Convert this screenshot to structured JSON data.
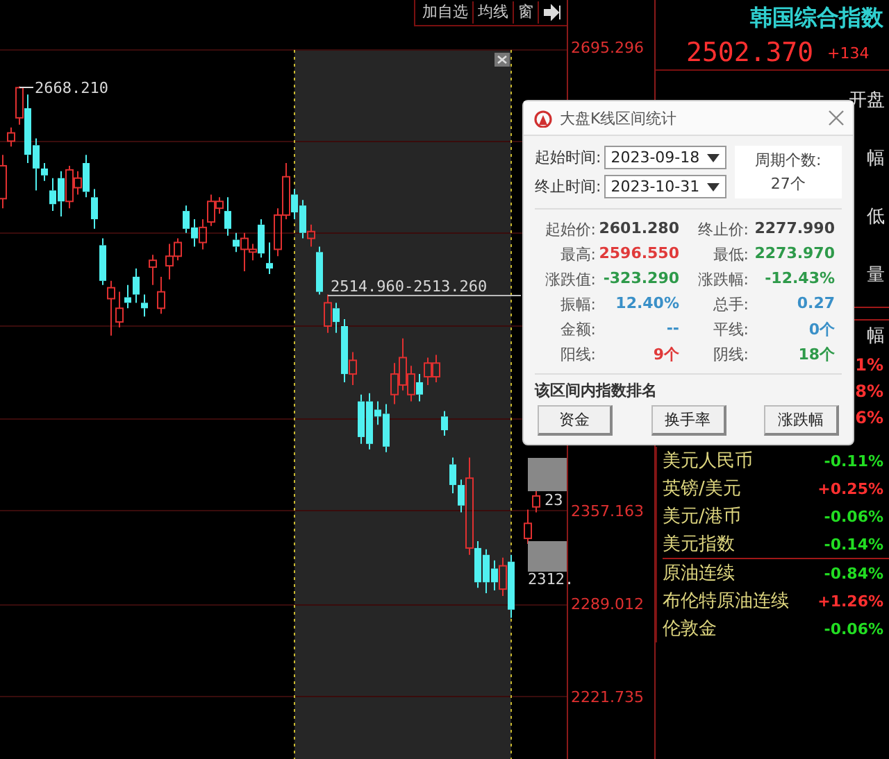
{
  "toolbar": {
    "buttons": [
      "加自选",
      "均线",
      "窗"
    ]
  },
  "chart": {
    "high_label": "2668.210",
    "range_label": "2514.960-2513.260",
    "price_tags": [
      "23",
      "2312."
    ],
    "chart_data": {
      "type": "candlestick",
      "grid": true,
      "ylim": [
        2178,
        2732
      ],
      "yticks": [
        {
          "value": 2695.296,
          "label": "2695.296"
        },
        {
          "value": 2357.163,
          "label": "2357.163"
        },
        {
          "value": 2289.012,
          "label": "2289.012"
        },
        {
          "value": 2221.735,
          "label": "2221.735"
        }
      ],
      "ohlc": [
        [
          2587,
          2619,
          2580,
          2611
        ],
        [
          2629,
          2639,
          2625,
          2635
        ],
        [
          2646,
          2669,
          2641,
          2668
        ],
        [
          2653,
          2663,
          2613,
          2619
        ],
        [
          2626,
          2631,
          2593,
          2609
        ],
        [
          2609,
          2613,
          2600,
          2604
        ],
        [
          2593,
          2602,
          2578,
          2583
        ],
        [
          2602,
          2607,
          2574,
          2585
        ],
        [
          2585,
          2611,
          2580,
          2608
        ],
        [
          2595,
          2607,
          2590,
          2602
        ],
        [
          2613,
          2619,
          2588,
          2592
        ],
        [
          2588,
          2594,
          2565,
          2572
        ],
        [
          2553,
          2558,
          2524,
          2527
        ],
        [
          2514,
          2527,
          2487,
          2522
        ],
        [
          2497,
          2519,
          2493,
          2507
        ],
        [
          2515,
          2524,
          2507,
          2511
        ],
        [
          2530,
          2536,
          2511,
          2517
        ],
        [
          2511,
          2517,
          2501,
          2507
        ],
        [
          2537,
          2546,
          2524,
          2542
        ],
        [
          2507,
          2530,
          2503,
          2519
        ],
        [
          2538,
          2554,
          2528,
          2545
        ],
        [
          2545,
          2558,
          2542,
          2555
        ],
        [
          2578,
          2582,
          2562,
          2565
        ],
        [
          2566,
          2572,
          2552,
          2558
        ],
        [
          2555,
          2572,
          2550,
          2566
        ],
        [
          2570,
          2590,
          2567,
          2585
        ],
        [
          2580,
          2588,
          2576,
          2585
        ],
        [
          2578,
          2588,
          2560,
          2565
        ],
        [
          2557,
          2562,
          2548,
          2552
        ],
        [
          2550,
          2562,
          2534,
          2558
        ],
        [
          2548,
          2554,
          2542,
          2550
        ],
        [
          2568,
          2572,
          2544,
          2547
        ],
        [
          2540,
          2555,
          2532,
          2536
        ],
        [
          2550,
          2580,
          2545,
          2575
        ],
        [
          2575,
          2613,
          2572,
          2603
        ],
        [
          2590,
          2594,
          2572,
          2577
        ],
        [
          2582,
          2586,
          2558,
          2562
        ],
        [
          2558,
          2568,
          2552,
          2563
        ],
        [
          2548,
          2552,
          2517,
          2519
        ],
        [
          2494,
          2517,
          2489,
          2511
        ],
        [
          2507,
          2511,
          2489,
          2497
        ],
        [
          2494,
          2499,
          2453,
          2459
        ],
        [
          2459,
          2475,
          2451,
          2469
        ],
        [
          2439,
          2444,
          2408,
          2413
        ],
        [
          2439,
          2445,
          2404,
          2408
        ],
        [
          2433,
          2439,
          2422,
          2428
        ],
        [
          2430,
          2437,
          2402,
          2406
        ],
        [
          2444,
          2467,
          2437,
          2459
        ],
        [
          2451,
          2485,
          2447,
          2471
        ],
        [
          2444,
          2465,
          2439,
          2459
        ],
        [
          2453,
          2459,
          2439,
          2444
        ],
        [
          2457,
          2471,
          2451,
          2467
        ],
        [
          2457,
          2473,
          2453,
          2467
        ],
        [
          2428,
          2432,
          2414,
          2418
        ],
        [
          2393,
          2398,
          2372,
          2378
        ],
        [
          2378,
          2382,
          2358,
          2363
        ],
        [
          2332,
          2398,
          2327,
          2383
        ],
        [
          2332,
          2337,
          2303,
          2307
        ],
        [
          2327,
          2331,
          2299,
          2307
        ],
        [
          2317,
          2323,
          2301,
          2307
        ],
        [
          2302,
          2325,
          2297,
          2319
        ],
        [
          2322,
          2327,
          2281,
          2287
        ],
        null,
        [
          2339,
          2360,
          2335,
          2350
        ],
        [
          2362,
          2374,
          2358,
          2370
        ]
      ]
    }
  },
  "quote": {
    "name": "韩国综合指数",
    "price": "2502.370",
    "change": "+134",
    "fields": [
      "开盘",
      "幅",
      "低",
      "量"
    ],
    "section_field": "幅",
    "changes": [
      "1%",
      "8%",
      "6%"
    ]
  },
  "markets": [
    {
      "name": "美元人民币",
      "change": "-0.11%",
      "color": "#22dd22"
    },
    {
      "name": "英镑/美元",
      "change": "+0.25%",
      "color": "#ff3030"
    },
    {
      "name": "美元/港币",
      "change": "-0.06%",
      "color": "#22dd22"
    },
    {
      "name": "美元指数",
      "change": "-0.14%",
      "color": "#22dd22"
    },
    {
      "name": "原油连续",
      "change": "-0.84%",
      "color": "#22dd22"
    },
    {
      "name": "布伦特原油连续",
      "change": "+1.26%",
      "color": "#ff3030"
    },
    {
      "name": "伦敦金",
      "change": "-0.06%",
      "color": "#22dd22"
    }
  ],
  "dialog": {
    "title": "大盘K线区间统计",
    "start_label": "起始时间:",
    "start_value": "2023-09-18",
    "end_label": "终止时间:",
    "end_value": "2023-10-31",
    "period_label": "周期个数:",
    "period_value": "27个",
    "stats": [
      {
        "label": "起始价:",
        "value": "2601.280",
        "color": "#404040"
      },
      {
        "label": "终止价:",
        "value": "2277.990",
        "color": "#404040"
      },
      {
        "label": "最高:",
        "value": "2596.550",
        "color": "#e03a3a"
      },
      {
        "label": "最低:",
        "value": "2273.970",
        "color": "#2e9a4a"
      },
      {
        "label": "涨跌值:",
        "value": "-323.290",
        "color": "#2e9a4a"
      },
      {
        "label": "涨跌幅:",
        "value": "-12.43%",
        "color": "#2e9a4a"
      },
      {
        "label": "振幅:",
        "value": "12.40%",
        "color": "#3a90c8"
      },
      {
        "label": "总手:",
        "value": "0.27",
        "color": "#3a90c8"
      },
      {
        "label": "金额:",
        "value": "--",
        "color": "#3a90c8"
      },
      {
        "label": "平线:",
        "value": "0个",
        "color": "#3a90c8"
      },
      {
        "label": "阳线:",
        "value": "9个",
        "color": "#e03a3a"
      },
      {
        "label": "阴线:",
        "value": "18个",
        "color": "#2e9a4a"
      }
    ],
    "section": "该区间内指数排名",
    "buttons": [
      "资金",
      "换手率",
      "涨跌幅"
    ]
  }
}
